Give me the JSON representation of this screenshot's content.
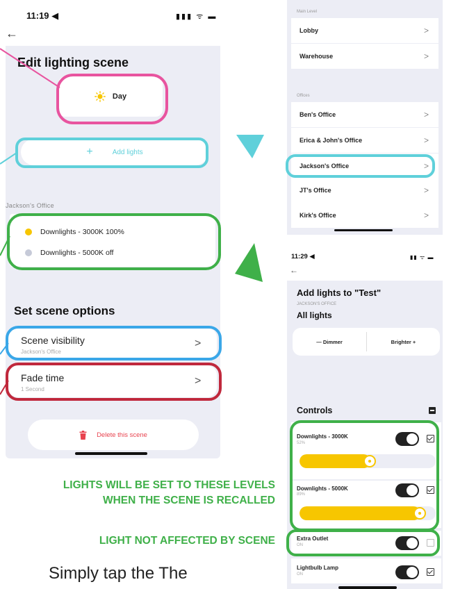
{
  "left_phone": {
    "time": "11:19 ◀",
    "status_icons": "▮▮▮ ᯤ ▬",
    "back_arrow": "←",
    "title": "Edit lighting scene",
    "scene_name": "Day",
    "add_lights_plus": "+",
    "add_lights_label": "Add lights",
    "room_section": "Jackson's Office",
    "lights": [
      {
        "label": "Downlights - 3000K 100%",
        "dot_color": "#f7c600"
      },
      {
        "label": "Downlights - 5000K off",
        "dot_color": "#c6cad8"
      }
    ],
    "options_heading": "Set scene options",
    "visibility_title": "Scene visibility",
    "visibility_sub": "Jackson's Office",
    "fade_title": "Fade time",
    "fade_sub": "1 Second",
    "chevron": ">",
    "delete_label": "Delete this scene"
  },
  "right_list": {
    "section1": "Main Level",
    "rows1": [
      "Lobby",
      "Warehouse"
    ],
    "section2": "Offices",
    "rows2": [
      "Ben's Office",
      "Erica & John's Office",
      "Jackson's Office",
      "JT's Office",
      "Kirk's Office"
    ],
    "chevron": ">"
  },
  "right_phone": {
    "time": "11:29 ◀",
    "status_icons": "▮▮ ᯤ ▬",
    "back_arrow": "←",
    "title": "Add lights to \"Test\"",
    "room": "JACKSON'S OFFICE",
    "all_lights": "All lights",
    "dimmer_label": "— Dimmer",
    "brighter_label": "Brighter +",
    "controls_heading": "Controls",
    "controls": [
      {
        "name": "Downlights - 3000K",
        "sub": "52%",
        "level": 0.52,
        "toggle_on": true,
        "checked": true
      },
      {
        "name": "Downlights - 5000K",
        "sub": "89%",
        "level": 0.89,
        "toggle_on": true,
        "checked": true
      },
      {
        "name": "Extra Outlet",
        "sub": "ON",
        "toggle_on": true,
        "checked": false
      },
      {
        "name": "Lightbulb Lamp",
        "sub": "ON",
        "toggle_on": true,
        "checked": true
      }
    ]
  },
  "captions": {
    "levels_line1": "LIGHTS WILL BE SET TO THESE LEVELS",
    "levels_line2": "WHEN THE SCENE IS RECALLED",
    "not_affected": "LIGHT NOT AFFECTED BY SCENE",
    "bottom_text": "Simply tap the The"
  },
  "colors": {
    "panel_bg": "#ecedf5",
    "pink": "#e8549f",
    "cyan": "#5fd0da",
    "green": "#3fb049",
    "blue": "#3aa7e8",
    "red": "#c0283c",
    "yellow": "#f7c600",
    "delete_red": "#e8434f"
  }
}
